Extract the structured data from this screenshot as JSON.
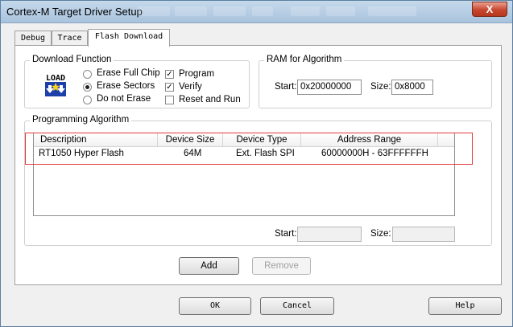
{
  "window": {
    "title": "Cortex-M Target Driver Setup",
    "close_glyph": "X"
  },
  "tabs": [
    {
      "label": "Debug"
    },
    {
      "label": "Trace"
    },
    {
      "label": "Flash Download",
      "active": true
    }
  ],
  "download_function": {
    "legend": "Download Function",
    "icon": {
      "name": "load-icon",
      "text": "LOAD"
    },
    "options": [
      {
        "label": "Erase Full Chip",
        "checked": false
      },
      {
        "label": "Erase Sectors",
        "checked": true
      },
      {
        "label": "Do not Erase",
        "checked": false
      }
    ],
    "checks": [
      {
        "label": "Program",
        "checked": true
      },
      {
        "label": "Verify",
        "checked": true
      },
      {
        "label": "Reset and Run",
        "checked": false
      }
    ]
  },
  "ram_for_algorithm": {
    "legend": "RAM for Algorithm",
    "start_label": "Start:",
    "start_value": "0x20000000",
    "size_label": "Size:",
    "size_value": "0x8000"
  },
  "programming_algorithm": {
    "legend": "Programming Algorithm",
    "columns": [
      "Description",
      "Device Size",
      "Device Type",
      "Address Range"
    ],
    "rows": [
      {
        "description": "RT1050 Hyper Flash",
        "device_size": "64M",
        "device_type": "Ext. Flash SPI",
        "address_range": "60000000H - 63FFFFFFH"
      }
    ],
    "start_label": "Start:",
    "start_value": "",
    "size_label": "Size:",
    "size_value": ""
  },
  "buttons": {
    "add": "Add",
    "remove": "Remove",
    "ok": "OK",
    "cancel": "Cancel",
    "help": "Help"
  },
  "colors": {
    "highlight": "#e23b3b",
    "titlebar": "#b9cfe5",
    "close": "#c8462f"
  }
}
